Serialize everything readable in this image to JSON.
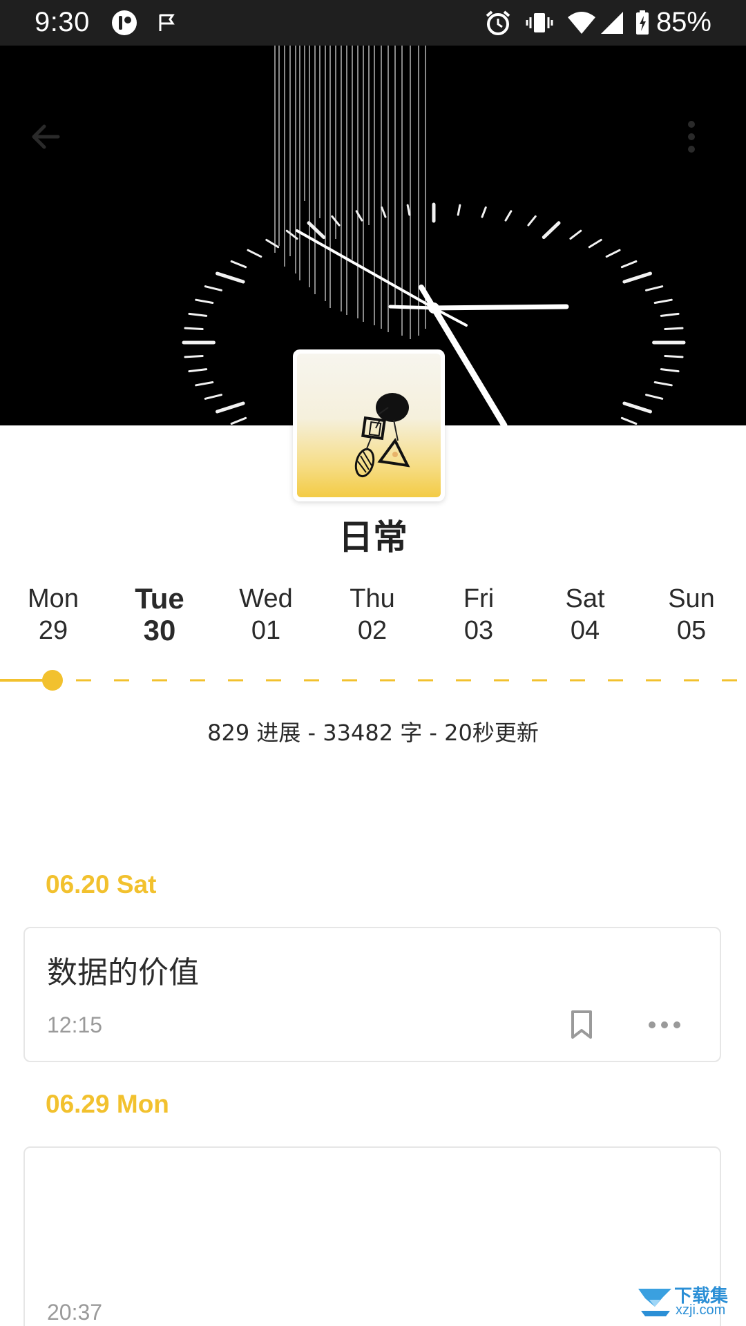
{
  "status_bar": {
    "time": "9:30",
    "battery": "85%",
    "icons": [
      "app-notification-icon",
      "flag-icon",
      "alarm-icon",
      "vibrate-icon",
      "wifi-icon",
      "signal-icon",
      "battery-charging-icon"
    ]
  },
  "header": {
    "back_icon": "arrow-left-icon",
    "menu_icon": "more-vertical-icon",
    "cover_image": "clock-face-photo"
  },
  "notebook": {
    "title": "日常",
    "stats": "829 进展 - 33482 字 - 20秒更新"
  },
  "week": {
    "days": [
      {
        "name": "Mon",
        "date": "29"
      },
      {
        "name": "Tue",
        "date": "30"
      },
      {
        "name": "Wed",
        "date": "01"
      },
      {
        "name": "Thu",
        "date": "02"
      },
      {
        "name": "Fri",
        "date": "03"
      },
      {
        "name": "Sat",
        "date": "04"
      },
      {
        "name": "Sun",
        "date": "05"
      }
    ],
    "selected_day": "Tue"
  },
  "entries": [
    {
      "date_label": "06.20 Sat",
      "title": "数据的价值",
      "time": "12:15"
    },
    {
      "date_label": "06.29 Mon",
      "title": "",
      "time": "20:37"
    }
  ],
  "colors": {
    "accent": "#f2c12e",
    "status_bar": "#1f1f1f",
    "card_border": "#e6e6e6",
    "secondary_text": "#9a9a9a"
  },
  "watermark": {
    "line1": "下载集",
    "line2": "xzji.com"
  }
}
